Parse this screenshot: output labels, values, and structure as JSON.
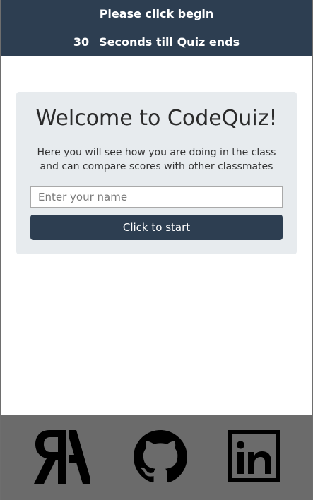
{
  "header": {
    "prompt": "Please click begin",
    "timer_count": "30",
    "timer_label": "Seconds till Quiz ends"
  },
  "card": {
    "title": "Welcome to CodeQuiz!",
    "description": "Here you will see how you are doing in the class and can compare scores with other classmates",
    "name_placeholder": "Enter your name",
    "name_value": "",
    "start_label": "Click to start"
  },
  "footer": {
    "links": [
      {
        "icon": "resume-logo-icon"
      },
      {
        "icon": "github-icon"
      },
      {
        "icon": "linkedin-icon"
      }
    ]
  },
  "colors": {
    "header_bg": "#2d3e51",
    "card_bg": "#e7ebee",
    "button_bg": "#2d3e51",
    "footer_bg": "#6b6b6b"
  }
}
